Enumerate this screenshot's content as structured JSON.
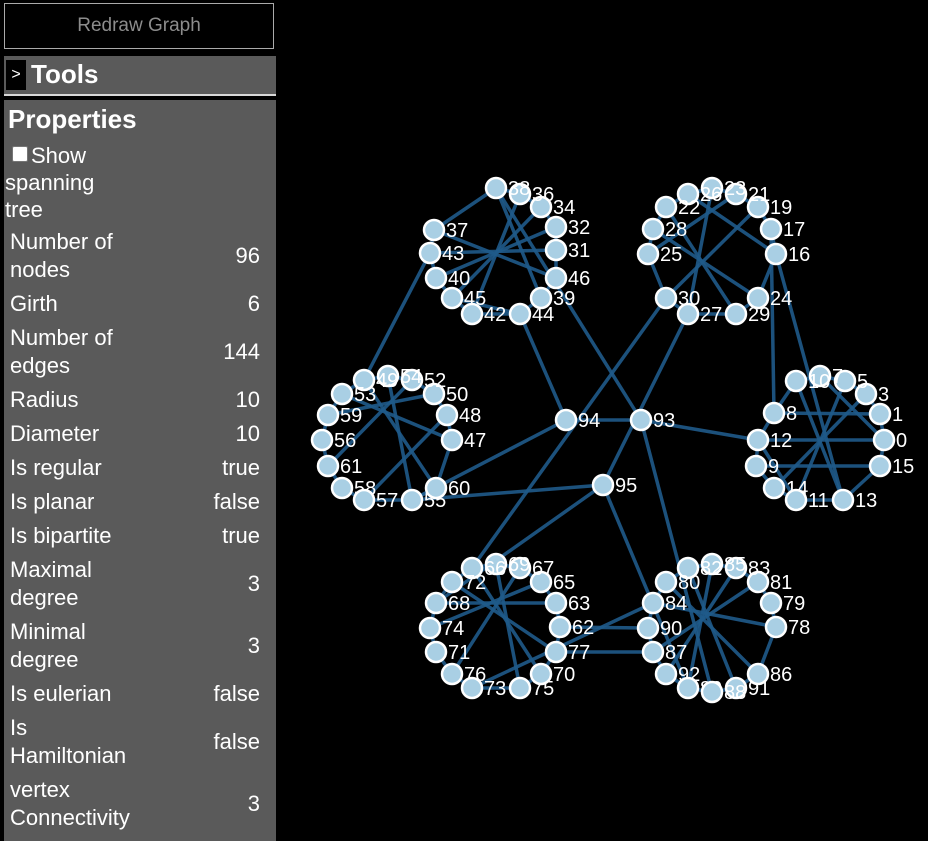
{
  "sidebar": {
    "redraw_label": "Redraw Graph",
    "tools": {
      "toggle": ">",
      "title": "Tools"
    },
    "properties": {
      "title": "Properties",
      "spanning_tree_label": "Show spanning tree",
      "rows": [
        {
          "label": "Number of nodes",
          "value": "96"
        },
        {
          "label": "Girth",
          "value": "6"
        },
        {
          "label": "Number of edges",
          "value": "144"
        },
        {
          "label": "Radius",
          "value": "10"
        },
        {
          "label": "Diameter",
          "value": "10"
        },
        {
          "label": "Is regular",
          "value": "true"
        },
        {
          "label": "Is planar",
          "value": "false"
        },
        {
          "label": "Is bipartite",
          "value": "true"
        },
        {
          "label": "Maximal degree",
          "value": "3"
        },
        {
          "label": "Minimal degree",
          "value": "3"
        },
        {
          "label": "Is eulerian",
          "value": "false"
        },
        {
          "label": "Is Hamiltonian",
          "value": "false"
        },
        {
          "label": "vertex Connectivity",
          "value": "3"
        }
      ]
    }
  },
  "colors": {
    "edge": "#1f5a8a",
    "node_fill": "#a9cfe4",
    "node_stroke": "#ffffff",
    "panel": "#5a5a5a"
  },
  "graph": {
    "nodes": [
      "0",
      "1",
      "3",
      "5",
      "7",
      "10",
      "8",
      "12",
      "9",
      "14",
      "11",
      "13",
      "15",
      "16",
      "17",
      "19",
      "21",
      "23",
      "26",
      "22",
      "28",
      "25",
      "30",
      "27",
      "29",
      "24",
      "31",
      "32",
      "34",
      "36",
      "38",
      "39",
      "37",
      "43",
      "40",
      "45",
      "42",
      "44",
      "46",
      "47",
      "48",
      "50",
      "52",
      "54",
      "49",
      "53",
      "59",
      "56",
      "61",
      "58",
      "57",
      "55",
      "60",
      "62",
      "63",
      "65",
      "67",
      "69",
      "66",
      "72",
      "68",
      "74",
      "71",
      "76",
      "73",
      "75",
      "70",
      "77",
      "78",
      "79",
      "81",
      "83",
      "85",
      "82",
      "80",
      "84",
      "90",
      "87",
      "92",
      "89",
      "91",
      "86",
      "88",
      "93",
      "94",
      "95"
    ]
  }
}
